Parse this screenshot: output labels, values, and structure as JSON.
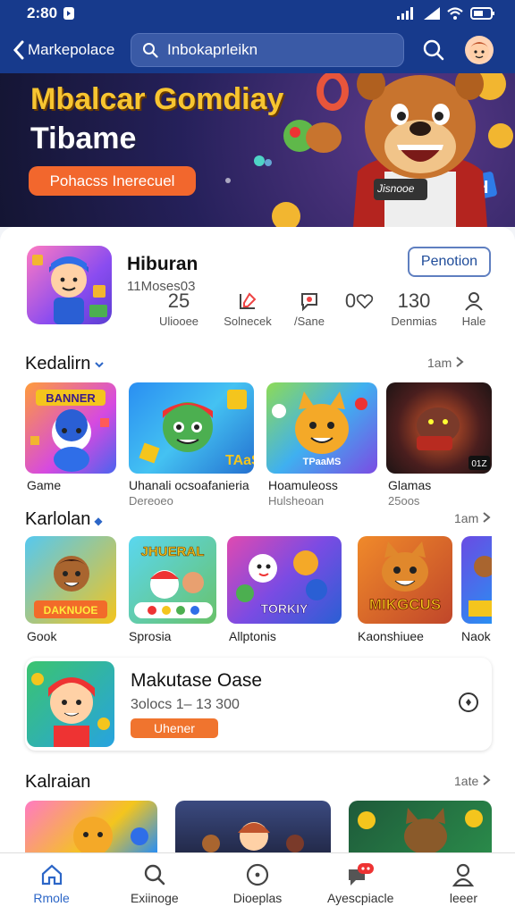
{
  "status": {
    "time": "2:80"
  },
  "header": {
    "back_label": "Markepolace",
    "search_value": "Inbokaprleikn"
  },
  "banner": {
    "line1": "Mbalcar Gomdiay",
    "line2": "Tibame",
    "button": "Pohacss Inerecuel",
    "sign": "Jisnooe"
  },
  "app": {
    "name": "Hiburan",
    "subtitle": "11Moses03",
    "follow": "Penotion"
  },
  "stats": [
    {
      "value": "25",
      "label": "Uliooee"
    },
    {
      "value": "",
      "label": "Solnecek"
    },
    {
      "value": "",
      "label": "/Sane"
    },
    {
      "value": "0",
      "label": ""
    },
    {
      "value": "130",
      "label": "Denmias"
    },
    {
      "value": "",
      "label": "Hale"
    }
  ],
  "section1": {
    "title": "Kedalirn",
    "more": "1am"
  },
  "row1": [
    {
      "label": "Game",
      "sub": "",
      "tile_text": "BANNER"
    },
    {
      "label": "Uhanali ocsoafanieria",
      "sub": "Dereoeo",
      "tile_text": "TAaSP"
    },
    {
      "label": "Hoamuleoss",
      "sub": "Hulsheoan",
      "tile_text": "TPaaMS"
    },
    {
      "label": "Glamas",
      "sub": "25oos",
      "tile_text": "01Z"
    }
  ],
  "section2": {
    "title": "Karlolan",
    "more": "1am"
  },
  "row2": [
    {
      "label": "Gook",
      "tile_text": "DAKNUOE"
    },
    {
      "label": "Sprosia",
      "tile_text": "JHUERAL"
    },
    {
      "label": "Allptonis",
      "tile_text": "TORKIY"
    },
    {
      "label": "Kaonshiuee",
      "tile_text": "MIKGCUS"
    },
    {
      "label": "Naok",
      "tile_text": ""
    }
  ],
  "promo": {
    "title": "Makutase Oase",
    "sub": "3olocs 1– 13 300",
    "badge": "Uhener"
  },
  "section3": {
    "title": "Kalraian",
    "more": "1ate"
  },
  "nav": [
    {
      "label": "Rmole",
      "icon": "home-icon"
    },
    {
      "label": "Exiinoge",
      "icon": "search-icon"
    },
    {
      "label": "Dioeplas",
      "icon": "disc-icon"
    },
    {
      "label": "Ayescpiacle",
      "icon": "chat-badge-icon"
    },
    {
      "label": "leeer",
      "icon": "profile-icon"
    }
  ]
}
